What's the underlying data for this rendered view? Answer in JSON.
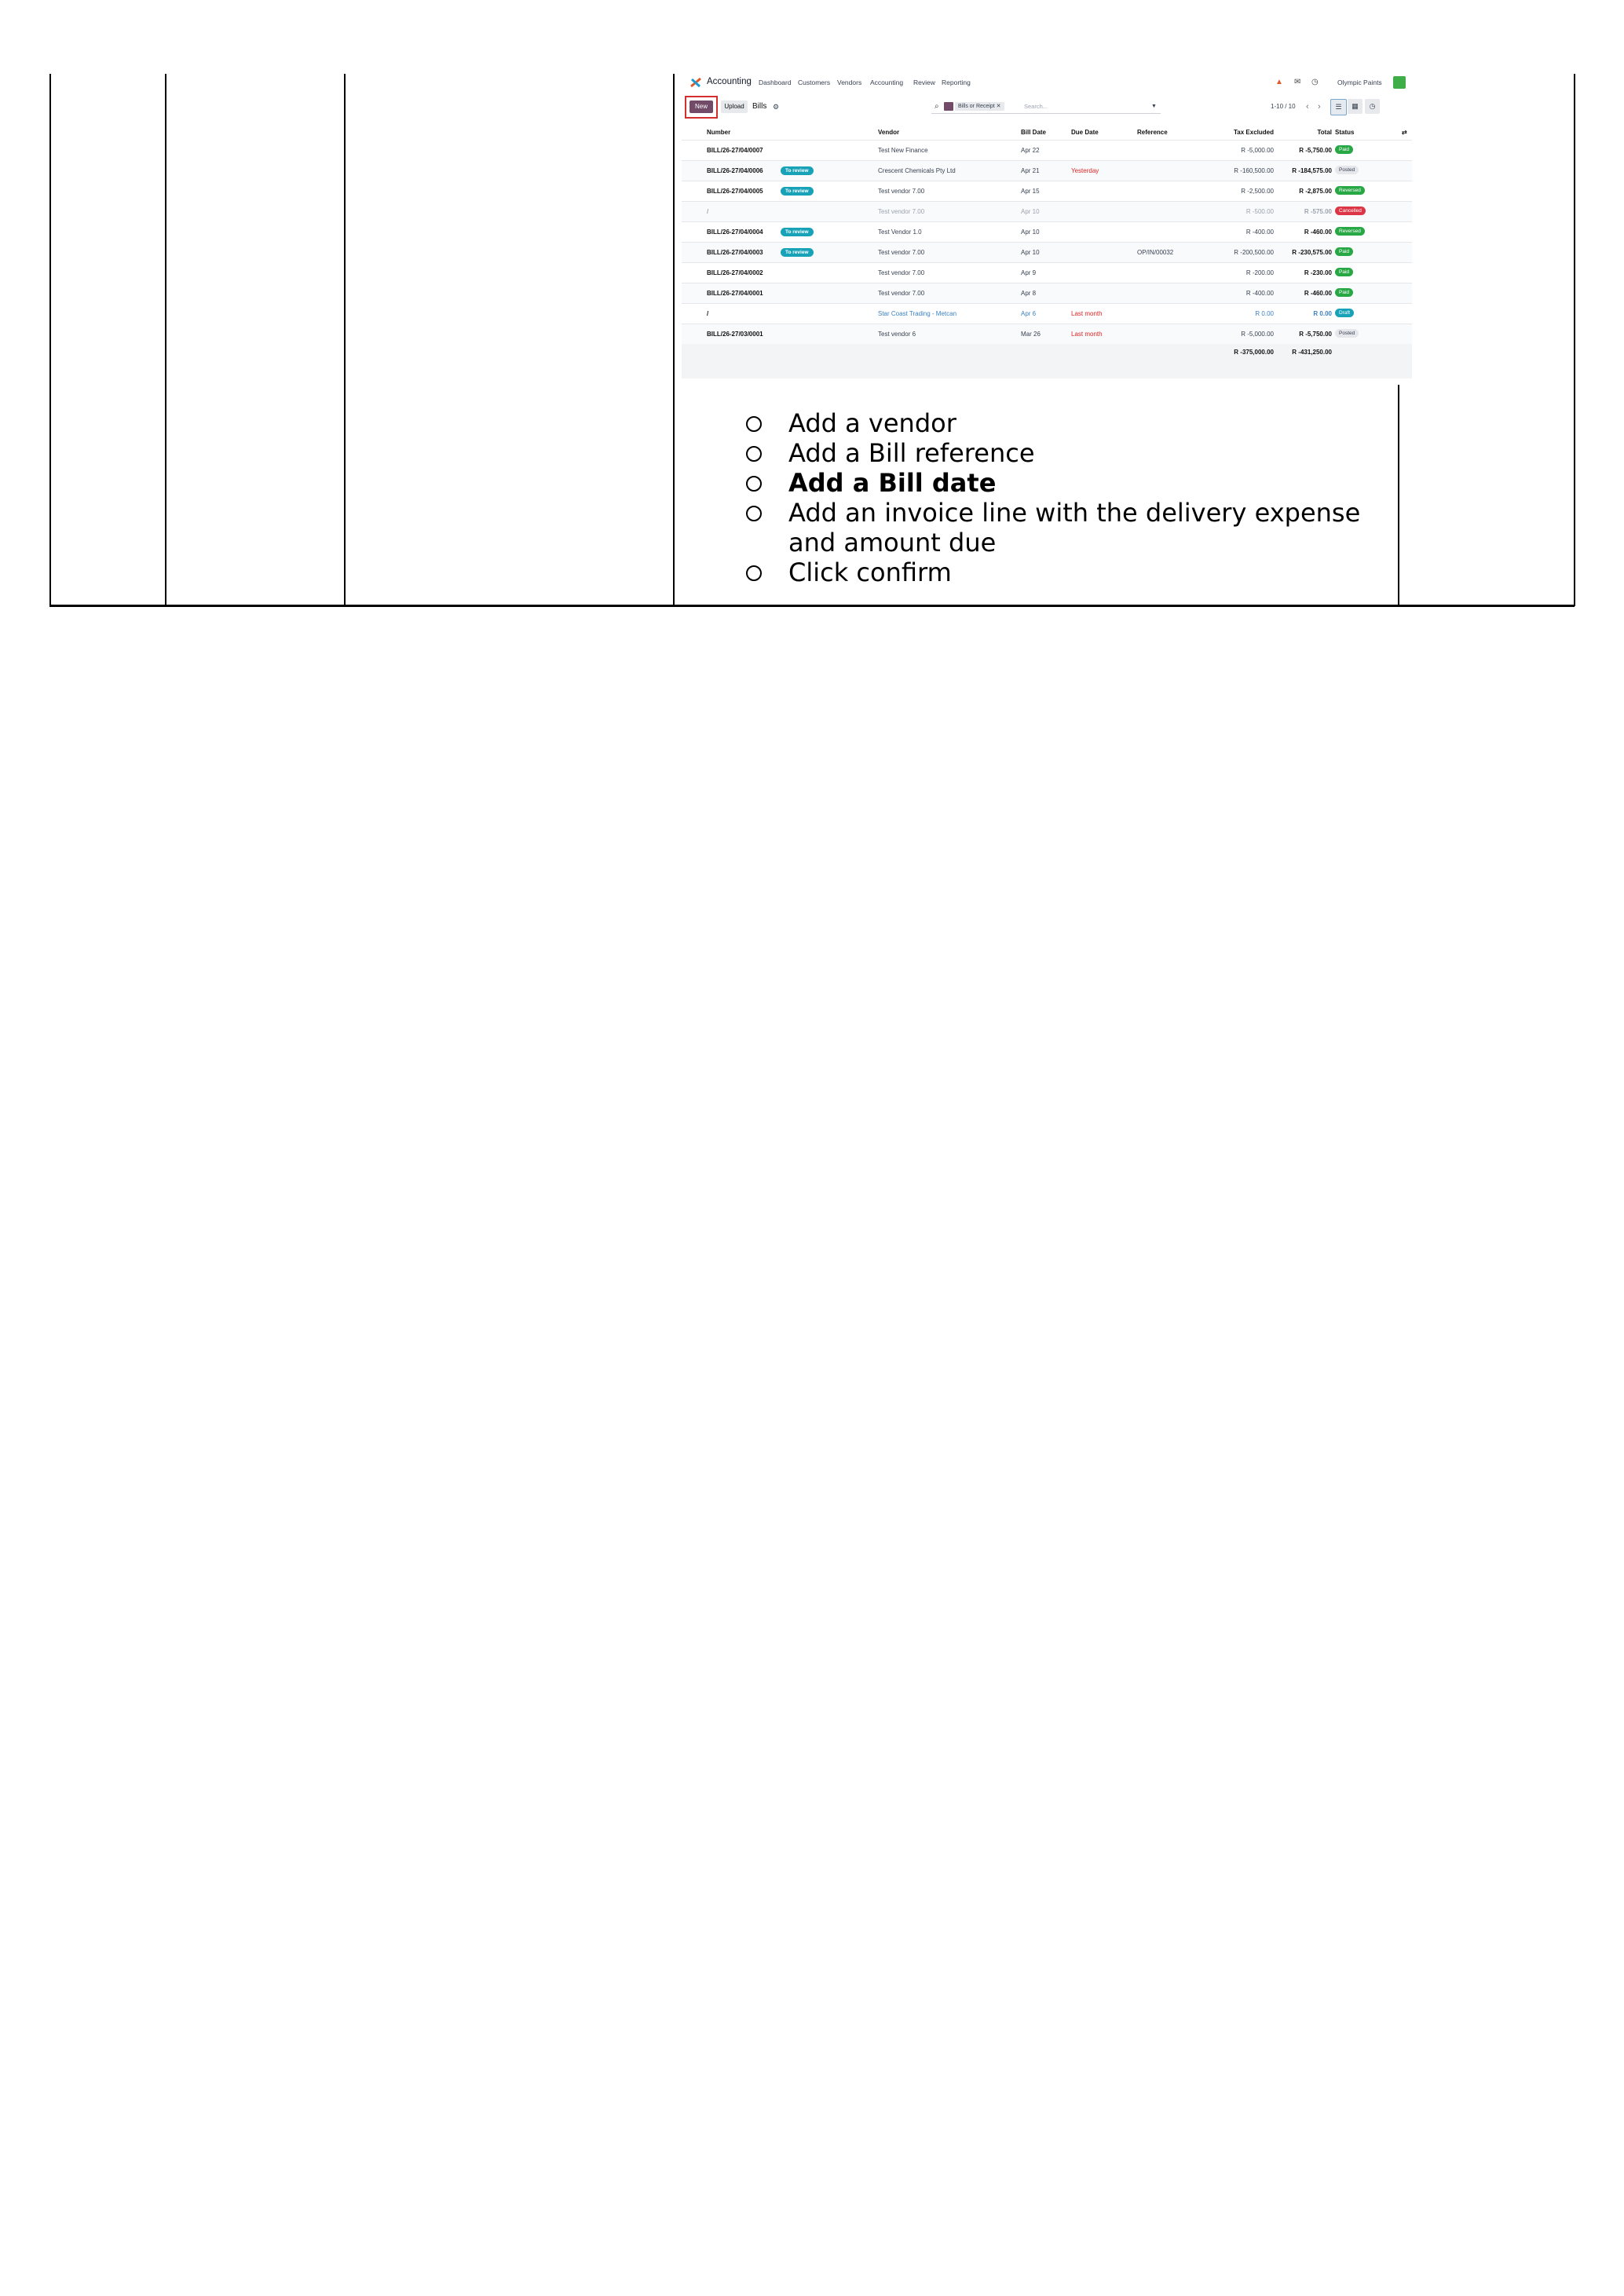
{
  "screenshot": {
    "app_name": "Accounting",
    "menu": [
      "Dashboard",
      "Customers",
      "Vendors",
      "Accounting",
      "Review",
      "Reporting"
    ],
    "company": "Olympic Paints",
    "new_label": "New",
    "upload_label": "Upload",
    "title": "Bills",
    "facet": "Bills or Receipt",
    "search_placeholder": "Search...",
    "pager": "1-10 / 10",
    "columns": [
      "Number",
      "Vendor",
      "Bill Date",
      "Due Date",
      "Reference",
      "Tax Excluded",
      "Total",
      "Status"
    ],
    "rows": [
      {
        "number": "BILL/26-27/04/0007",
        "badge": "",
        "vendor": "Test New Finance",
        "bill_date": "Apr 22",
        "due": "",
        "reference": "",
        "tax_excluded": "R -5,000.00",
        "total": "R -5,750.00",
        "status": "Paid"
      },
      {
        "number": "BILL/26-27/04/0006",
        "badge": "To review",
        "vendor": "Crescent Chemicals Pty Ltd",
        "bill_date": "Apr 21",
        "due": "Yesterday",
        "reference": "",
        "tax_excluded": "R -160,500.00",
        "total": "R -184,575.00",
        "status": "Posted"
      },
      {
        "number": "BILL/26-27/04/0005",
        "badge": "To review",
        "vendor": "Test vendor 7.00",
        "bill_date": "Apr 15",
        "due": "",
        "reference": "",
        "tax_excluded": "R -2,500.00",
        "total": "R -2,875.00",
        "status": "Reversed"
      },
      {
        "number": "/",
        "badge": "",
        "vendor": "Test vendor 7.00",
        "bill_date": "Apr 10",
        "due": "",
        "reference": "",
        "tax_excluded": "R -500.00",
        "total": "R -575.00",
        "status": "Cancelled"
      },
      {
        "number": "BILL/26-27/04/0004",
        "badge": "To review",
        "vendor": "Test Vendor 1.0",
        "bill_date": "Apr 10",
        "due": "",
        "reference": "",
        "tax_excluded": "R -400.00",
        "total": "R -460.00",
        "status": "Reversed"
      },
      {
        "number": "BILL/26-27/04/0003",
        "badge": "To review",
        "vendor": "Test vendor 7.00",
        "bill_date": "Apr 10",
        "due": "",
        "reference": "OP/IN/00032",
        "tax_excluded": "R -200,500.00",
        "total": "R -230,575.00",
        "status": "Paid"
      },
      {
        "number": "BILL/26-27/04/0002",
        "badge": "",
        "vendor": "Test vendor 7.00",
        "bill_date": "Apr 9",
        "due": "",
        "reference": "",
        "tax_excluded": "R -200.00",
        "total": "R -230.00",
        "status": "Paid"
      },
      {
        "number": "BILL/26-27/04/0001",
        "badge": "",
        "vendor": "Test vendor 7.00",
        "bill_date": "Apr 8",
        "due": "",
        "reference": "",
        "tax_excluded": "R -400.00",
        "total": "R -460.00",
        "status": "Paid"
      },
      {
        "number": "/",
        "badge": "",
        "vendor": "Star Coast Trading - Metcan",
        "bill_date": "Apr 6",
        "due": "Last month",
        "reference": "",
        "tax_excluded": "R 0.00",
        "total": "R 0.00",
        "status": "Draft"
      },
      {
        "number": "BILL/26-27/03/0001",
        "badge": "",
        "vendor": "Test vendor 6",
        "bill_date": "Mar 26",
        "due": "Last month",
        "reference": "",
        "tax_excluded": "R -5,000.00",
        "total": "R -5,750.00",
        "status": "Posted"
      }
    ],
    "total_tax_excluded": "R -375,000.00",
    "total_total": "R -431,250.00",
    "colors": {
      "primary": "#714b67",
      "paid": "#28a745",
      "posted": "#e5e7eb",
      "reversed": "#28a745",
      "cancelled": "#dc3545",
      "draft": "#17a2b8",
      "to_review": "#17a2b8"
    }
  },
  "steps": [
    {
      "text": "Add a vendor",
      "bold": false
    },
    {
      "text": "Add a Bill reference",
      "bold": false
    },
    {
      "text": "Add a Bill date",
      "bold": true
    },
    {
      "text": "Add an invoice line with the delivery expense and amount due",
      "bold": false
    },
    {
      "text": "Click confirm",
      "bold": false
    }
  ]
}
